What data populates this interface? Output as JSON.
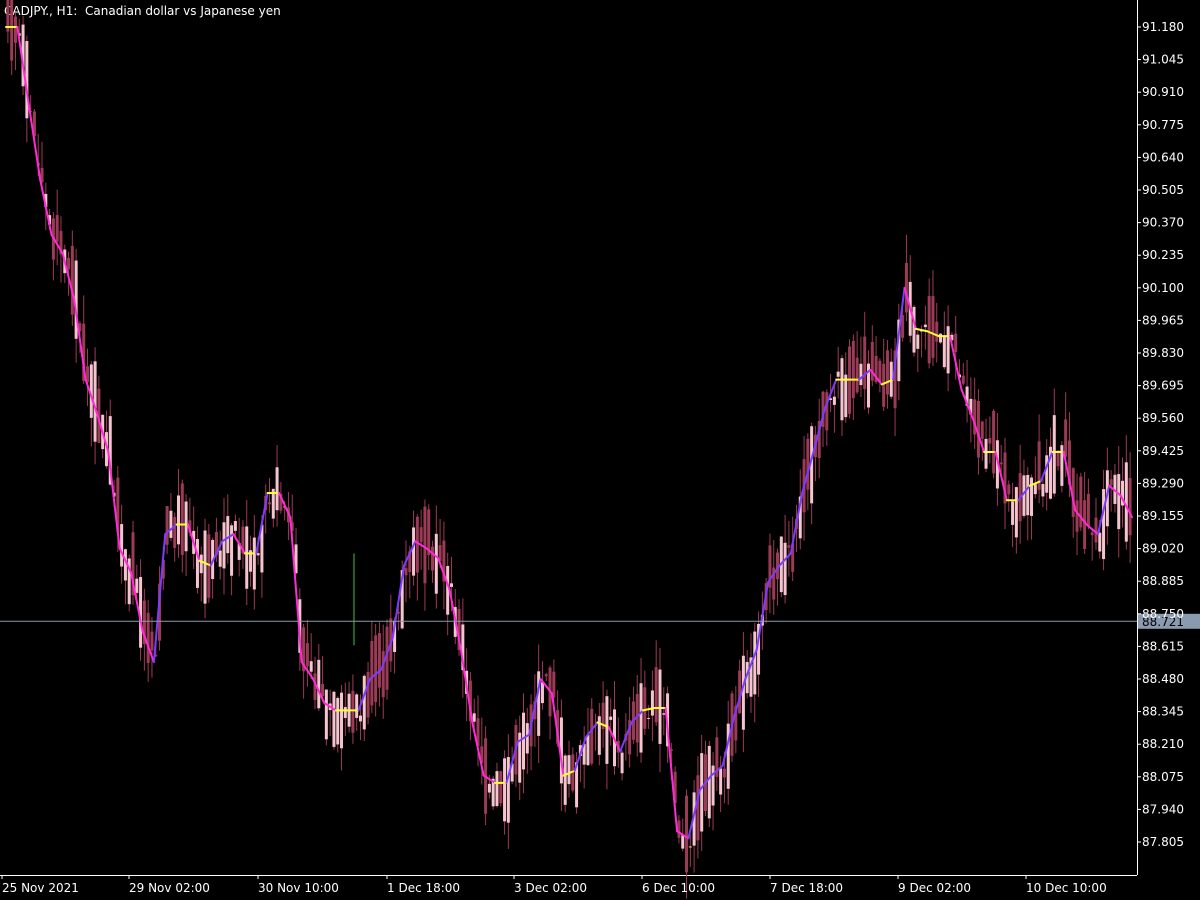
{
  "window": {
    "title": "CADJPY., H1:  Canadian dollar vs Japanese yen"
  },
  "colors": {
    "background": "#000000",
    "axis": "#ffffff",
    "candle_bull": "#f5c4cf",
    "candle_bear": "#9c3b55",
    "candle_highlight_green": "#3fbf3f",
    "ma_up": "#7c3cff",
    "ma_down": "#ff2bd6",
    "ma_flat": "#ffff33",
    "price_line": "#8a9bb0",
    "price_badge_bg": "#8a9bb0",
    "price_badge_text": "#000000"
  },
  "chart_data": {
    "type": "line",
    "symbol": "CADJPY.",
    "timeframe": "H1",
    "title": "Canadian dollar vs Japanese yen",
    "y_ticks": [
      "91.180",
      "91.045",
      "90.910",
      "90.775",
      "90.640",
      "90.505",
      "90.370",
      "90.235",
      "90.100",
      "89.965",
      "89.830",
      "89.695",
      "89.560",
      "89.425",
      "89.290",
      "89.155",
      "89.020",
      "88.885",
      "88.750",
      "88.615",
      "88.480",
      "88.345",
      "88.210",
      "88.075",
      "87.940",
      "87.805"
    ],
    "x_ticks": [
      "25 Nov 2021",
      "29 Nov 02:00",
      "30 Nov 10:00",
      "1 Dec 18:00",
      "3 Dec 02:00",
      "6 Dec 10:00",
      "7 Dec 18:00",
      "9 Dec 02:00",
      "10 Dec 10:00"
    ],
    "ylim": [
      87.72,
      91.24
    ],
    "current_price": "88.721",
    "series": [
      {
        "name": "",
        "values": [
          91.18,
          91.18,
          90.86,
          90.55,
          90.32,
          90.24,
          90.05,
          89.72,
          89.58,
          89.42,
          89.02,
          88.92,
          88.68,
          88.55,
          89.08,
          89.12,
          89.12,
          88.97,
          88.95,
          89.05,
          89.08,
          89.0,
          89.0,
          89.25,
          89.25,
          89.15,
          88.55,
          88.48,
          88.38,
          88.35,
          88.35,
          88.35,
          88.48,
          88.52,
          88.65,
          88.95,
          89.05,
          89.02,
          88.98,
          88.85,
          88.6,
          88.3,
          88.08,
          88.05,
          88.05,
          88.22,
          88.25,
          88.48,
          88.42,
          88.08,
          88.1,
          88.24,
          88.3,
          88.28,
          88.18,
          88.3,
          88.35,
          88.36,
          88.36,
          87.85,
          87.82,
          88.02,
          88.08,
          88.12,
          88.32,
          88.48,
          88.6,
          88.88,
          88.95,
          89.0,
          89.25,
          89.42,
          89.6,
          89.72,
          89.72,
          89.72,
          89.76,
          89.7,
          89.72,
          90.1,
          89.93,
          89.92,
          89.9,
          89.9,
          89.68,
          89.56,
          89.42,
          89.42,
          89.22,
          89.22,
          89.28,
          89.3,
          89.42,
          89.42,
          89.18,
          89.12,
          89.08,
          89.28,
          89.24,
          89.15
        ]
      }
    ],
    "grid": false,
    "legend": "none"
  }
}
